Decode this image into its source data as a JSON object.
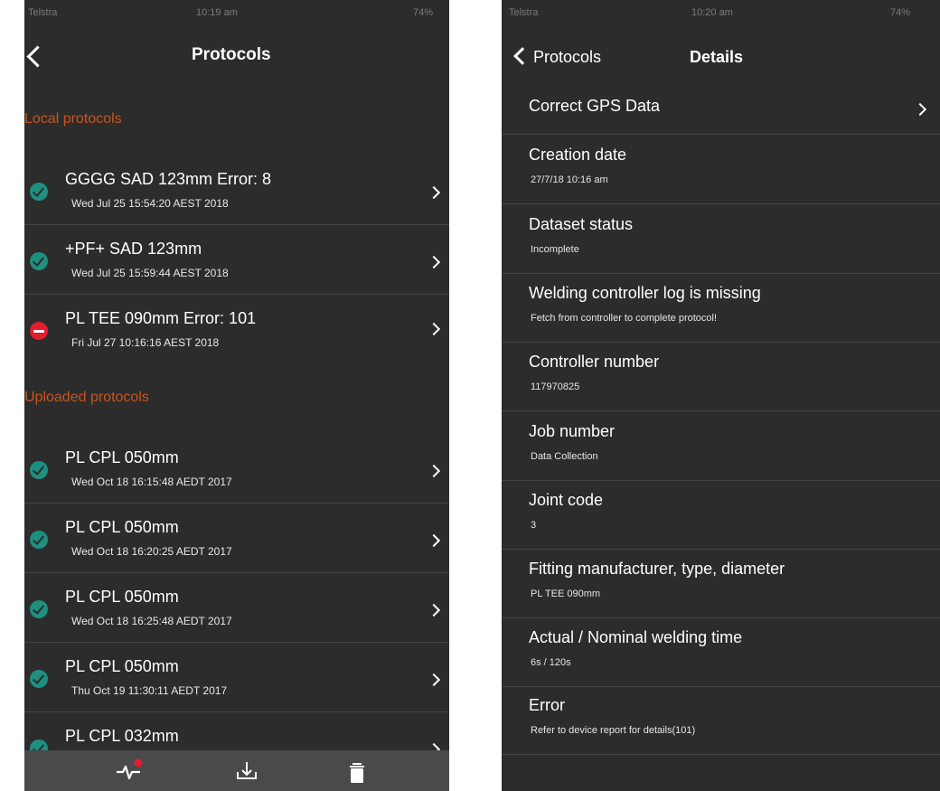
{
  "left": {
    "status": {
      "carrier": "Telstra",
      "time": "10:19 am",
      "battery": "74%"
    },
    "nav": {
      "title": "Protocols",
      "back_icon": "chevron-left-icon"
    },
    "local_section": "Local protocols",
    "uploaded_section": "Uploaded protocols",
    "local": [
      {
        "name": "GGGG SAD 123mm Error:  8",
        "date": "Wed Jul 25 15:54:20 AEST 2018",
        "status": "ok"
      },
      {
        "name": "+PF+ SAD 123mm",
        "date": "Wed Jul 25 15:59:44 AEST 2018",
        "status": "ok"
      },
      {
        "name": "PL TEE 090mm Error:  101",
        "date": "Fri Jul 27 10:16:16 AEST 2018",
        "status": "error"
      }
    ],
    "uploaded": [
      {
        "name": "PL CPL 050mm",
        "date": "Wed Oct 18 16:15:48 AEDT 2017",
        "status": "ok"
      },
      {
        "name": "PL CPL 050mm",
        "date": "Wed Oct 18 16:20:25 AEDT 2017",
        "status": "ok"
      },
      {
        "name": "PL CPL 050mm",
        "date": "Wed Oct 18 16:25:48 AEDT 2017",
        "status": "ok"
      },
      {
        "name": "PL CPL 050mm",
        "date": "Thu Oct 19 11:30:11 AEDT 2017",
        "status": "ok"
      },
      {
        "name": "PL CPL 032mm",
        "date": "",
        "status": "ok"
      }
    ],
    "toolbar": [
      "pulse-icon",
      "download-icon",
      "trash-icon"
    ]
  },
  "right": {
    "status": {
      "carrier": "Telstra",
      "time": "10:20 am",
      "battery": "74%"
    },
    "nav": {
      "back_label": "Protocols",
      "title": "Details"
    },
    "rows": [
      {
        "title": "Correct GPS Data",
        "value": ""
      },
      {
        "title": "Creation date",
        "value": "27/7/18 10:16 am"
      },
      {
        "title": "Dataset status",
        "value": "Incomplete"
      },
      {
        "title": "Welding controller log is missing",
        "value": "Fetch from controller to complete protocol!"
      },
      {
        "title": "Controller number",
        "value": "117970825"
      },
      {
        "title": "Job number",
        "value": "Data Collection"
      },
      {
        "title": "Joint code",
        "value": "3"
      },
      {
        "title": "Fitting manufacturer, type, diameter",
        "value": "PL TEE 090mm"
      },
      {
        "title": "Actual / Nominal welding time",
        "value": "6s / 120s"
      },
      {
        "title": "Error",
        "value": "Refer to device report for details(101)"
      }
    ]
  },
  "colors": {
    "background": "#2c2c2c",
    "section": "#c8541f",
    "ok": "#1f8f80",
    "error": "#e01e2e",
    "toolbar": "#4a4a4a"
  }
}
